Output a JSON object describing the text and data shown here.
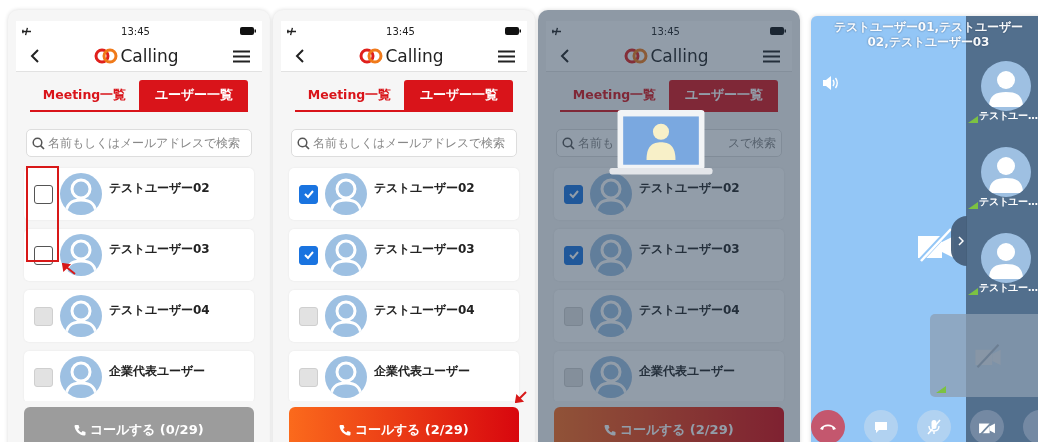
{
  "screens": [
    {
      "kind": "list",
      "time": "13:45",
      "app_name": "Calling",
      "tabs": [
        {
          "label": "Meeting一覧",
          "selected": false
        },
        {
          "label": "ユーザー一覧",
          "selected": true
        }
      ],
      "search": {
        "placeholder": "名前もしくはメールアドレスで検索"
      },
      "users": [
        {
          "name": "テストユーザー02",
          "checked": false,
          "disabled": false
        },
        {
          "name": "テストユーザー03",
          "checked": false,
          "disabled": false
        },
        {
          "name": "テストユーザー04",
          "checked": false,
          "disabled": true
        },
        {
          "name": "企業代表ユーザー",
          "checked": false,
          "disabled": true
        }
      ],
      "call_button": {
        "label": "コールする (0/29)",
        "disabled": true
      },
      "checkbox_callout": true,
      "button_callout": false,
      "overlay": false
    },
    {
      "kind": "list",
      "time": "13:45",
      "app_name": "Calling",
      "tabs": [
        {
          "label": "Meeting一覧",
          "selected": false
        },
        {
          "label": "ユーザー一覧",
          "selected": true
        }
      ],
      "search": {
        "placeholder": "名前もしくはメールアドレスで検索"
      },
      "users": [
        {
          "name": "テストユーザー02",
          "checked": true,
          "disabled": false
        },
        {
          "name": "テストユーザー03",
          "checked": true,
          "disabled": false
        },
        {
          "name": "テストユーザー04",
          "checked": false,
          "disabled": true
        },
        {
          "name": "企業代表ユーザー",
          "checked": false,
          "disabled": true
        }
      ],
      "call_button": {
        "label": "コールする (2/29)",
        "disabled": false
      },
      "checkbox_callout": false,
      "button_callout": true,
      "overlay": false
    },
    {
      "kind": "list",
      "time": "13:45",
      "app_name": "Calling",
      "tabs": [
        {
          "label": "Meeting一覧",
          "selected": false
        },
        {
          "label": "ユーザー一覧",
          "selected": true
        }
      ],
      "search": {
        "visible_parts": [
          "名前も",
          "スで検索"
        ]
      },
      "users": [
        {
          "name": "テストユーザー02",
          "checked": true,
          "disabled": false
        },
        {
          "name": "テストユーザー03",
          "checked": true,
          "disabled": false
        },
        {
          "name": "テストユーザー04",
          "checked": false,
          "disabled": true
        },
        {
          "name": "企業代表ユーザー",
          "checked": false,
          "disabled": true
        }
      ],
      "call_button": {
        "label": "コールする (2/29)",
        "disabled": false
      },
      "checkbox_callout": false,
      "button_callout": false,
      "overlay": true
    },
    {
      "kind": "call",
      "title": "テストユーザー01,テストユーザー02,テストユーザー03",
      "participants": [
        {
          "name": "テストユー…"
        },
        {
          "name": "テストユー…"
        },
        {
          "name": "テストユー…"
        }
      ]
    }
  ]
}
